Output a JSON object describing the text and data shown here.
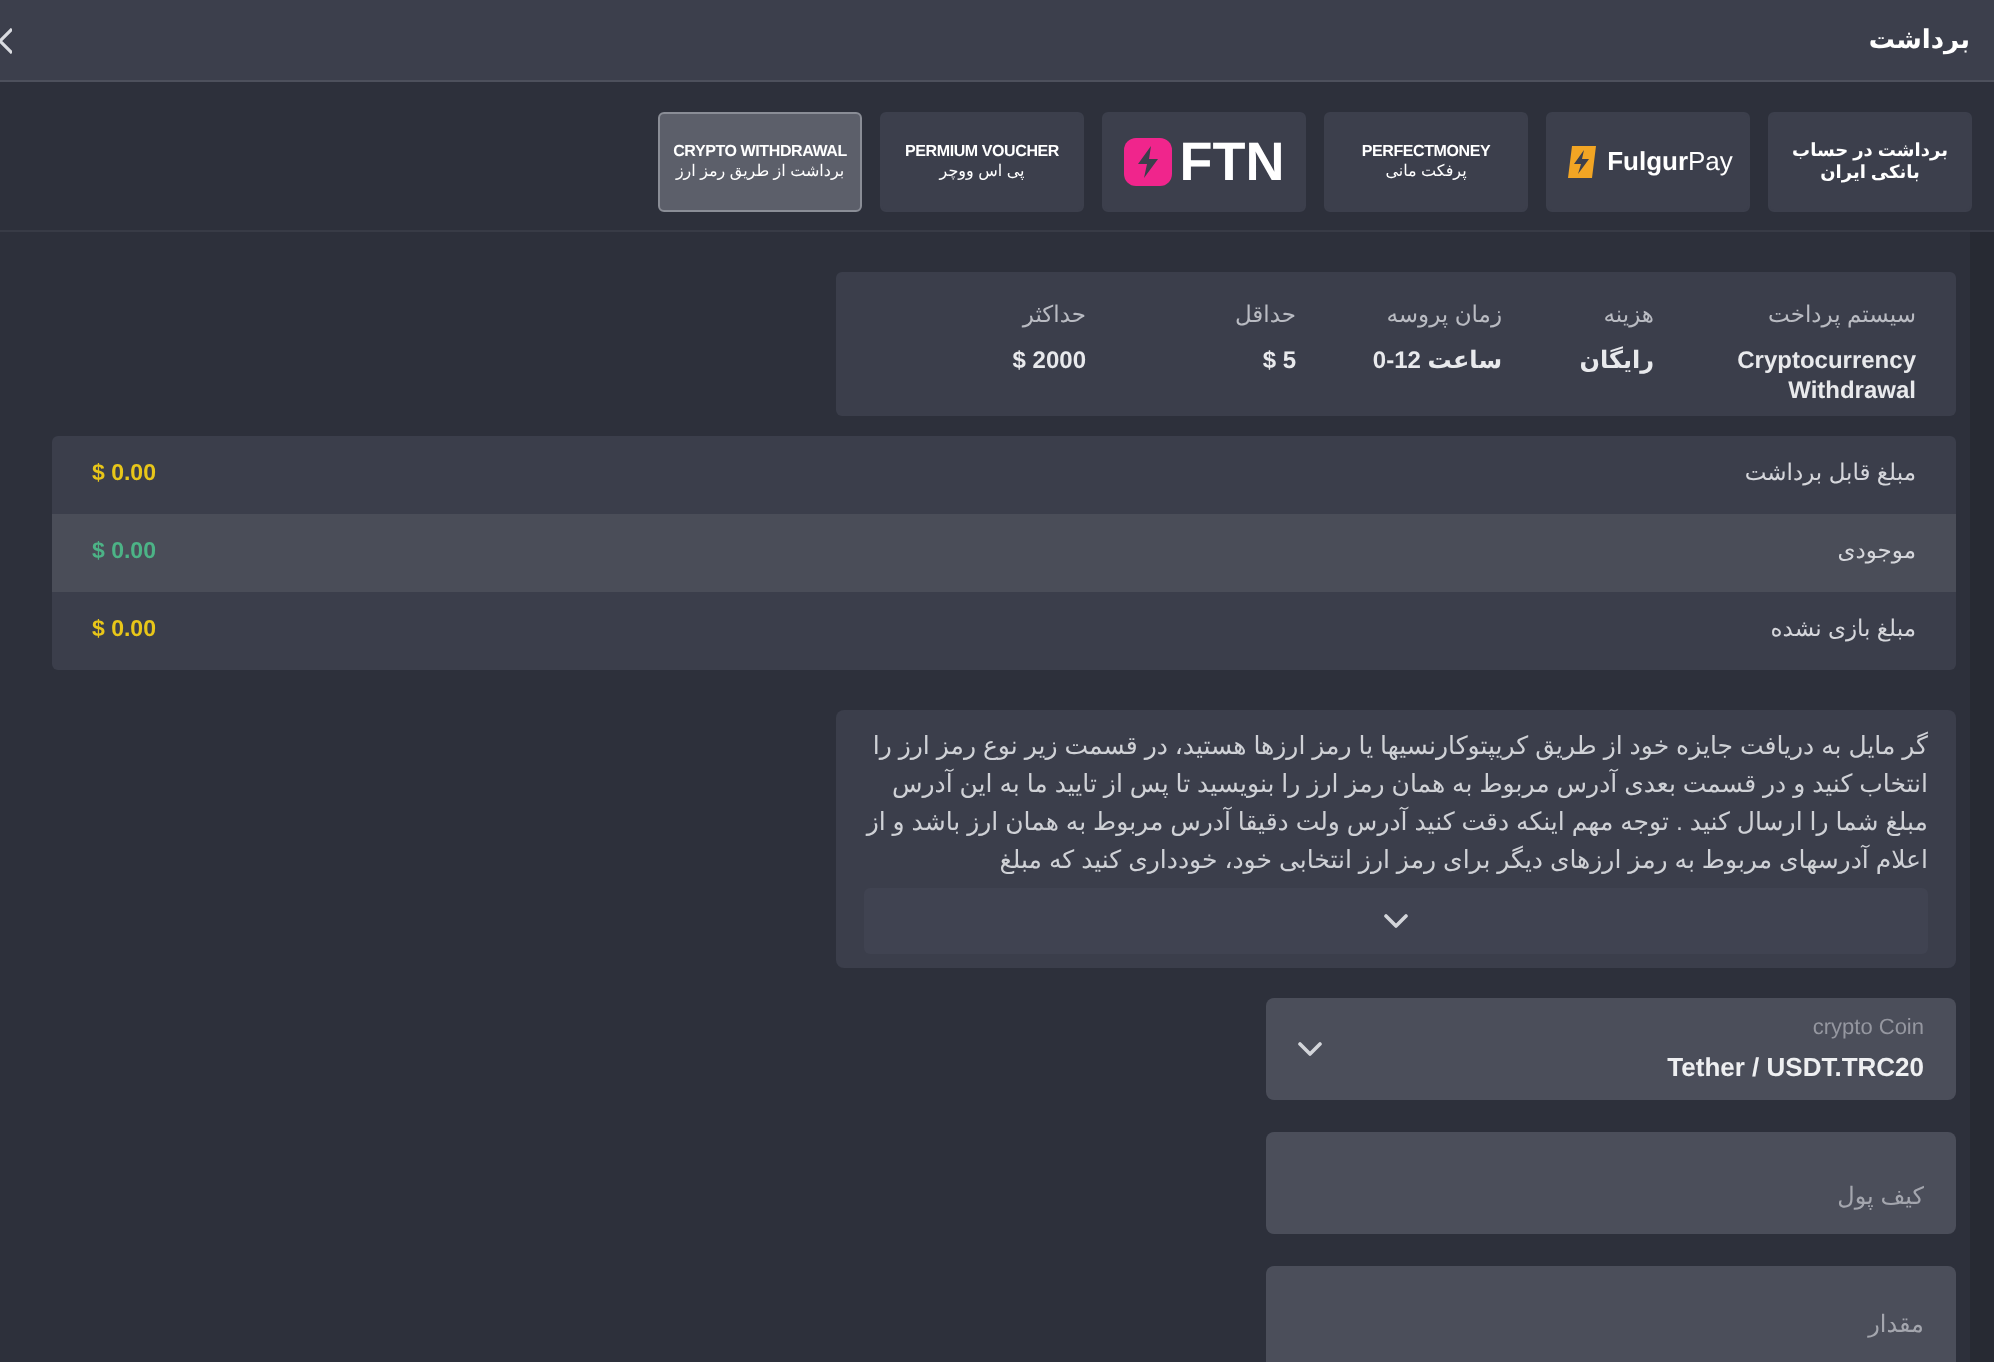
{
  "header": {
    "title": "برداشت"
  },
  "methods": [
    {
      "kind": "text",
      "title": "برداشت در حساب بانکی ایران",
      "selected": false
    },
    {
      "kind": "fulgurpay",
      "title": "**Fulgur**Pay",
      "selected": false
    },
    {
      "kind": "wordmark",
      "title": "PERFECTMONEY",
      "subtitle": "پرفکت مانی",
      "selected": false
    },
    {
      "kind": "ftn",
      "title": "FTN",
      "selected": false
    },
    {
      "kind": "wordmark",
      "title": "PERMIUM VOUCHER",
      "subtitle": "پی اس ووچر",
      "selected": false
    },
    {
      "kind": "wordmark",
      "title": "CRYPTO WITHDRAWAL",
      "subtitle": "برداشت از طریق رمز ارز",
      "selected": true
    }
  ],
  "info_table": {
    "columns": [
      {
        "label": "سیستم پرداخت",
        "value": "Cryptocurrency Withdrawal"
      },
      {
        "label": "هزینه",
        "value": "رایگان"
      },
      {
        "label": "زمان پروسه",
        "value": "0-12 ساعت"
      },
      {
        "label": "حداقل",
        "value": "$ 5"
      },
      {
        "label": "حداکثر",
        "value": "$ 2000"
      }
    ]
  },
  "balances": [
    {
      "label": "مبلغ قابل برداشت",
      "value": "$ 0.00",
      "color": "#e8c619",
      "highlighted": false
    },
    {
      "label": "موجودی",
      "value": "$ 0.00",
      "color": "#4cb386",
      "highlighted": true
    },
    {
      "label": "مبلغ بازی نشده",
      "value": "$ 0.00",
      "color": "#e8c619",
      "highlighted": false
    }
  ],
  "description": {
    "text": "گر مایل به دریافت جایزه خود از طریق کریپتوکارنسیها یا رمز ارزها هستید، در قسمت زیر نوع رمز ارز را انتخاب کنید و در قسمت بعدی آدرس مربوط به همان رمز ارز را بنویسید تا پس از تایید ما به این آدرس مبلغ شما را ارسال کنید . توجه مهم اینکه دقت کنید آدرس ولت دقیقا آدرس مربوط به همان ارز باشد و از اعلام آدرسهای مربوط به رمز ارزهای دیگر برای رمز ارز انتخابی خود، خودداری کنید که مبلغ",
    "expanded": false
  },
  "form": {
    "coin_select": {
      "label": "crypto Coin",
      "value": "Tether / USDT.TRC20"
    },
    "wallet": {
      "placeholder": "کیف پول"
    },
    "amount": {
      "placeholder": "مقدار"
    }
  }
}
